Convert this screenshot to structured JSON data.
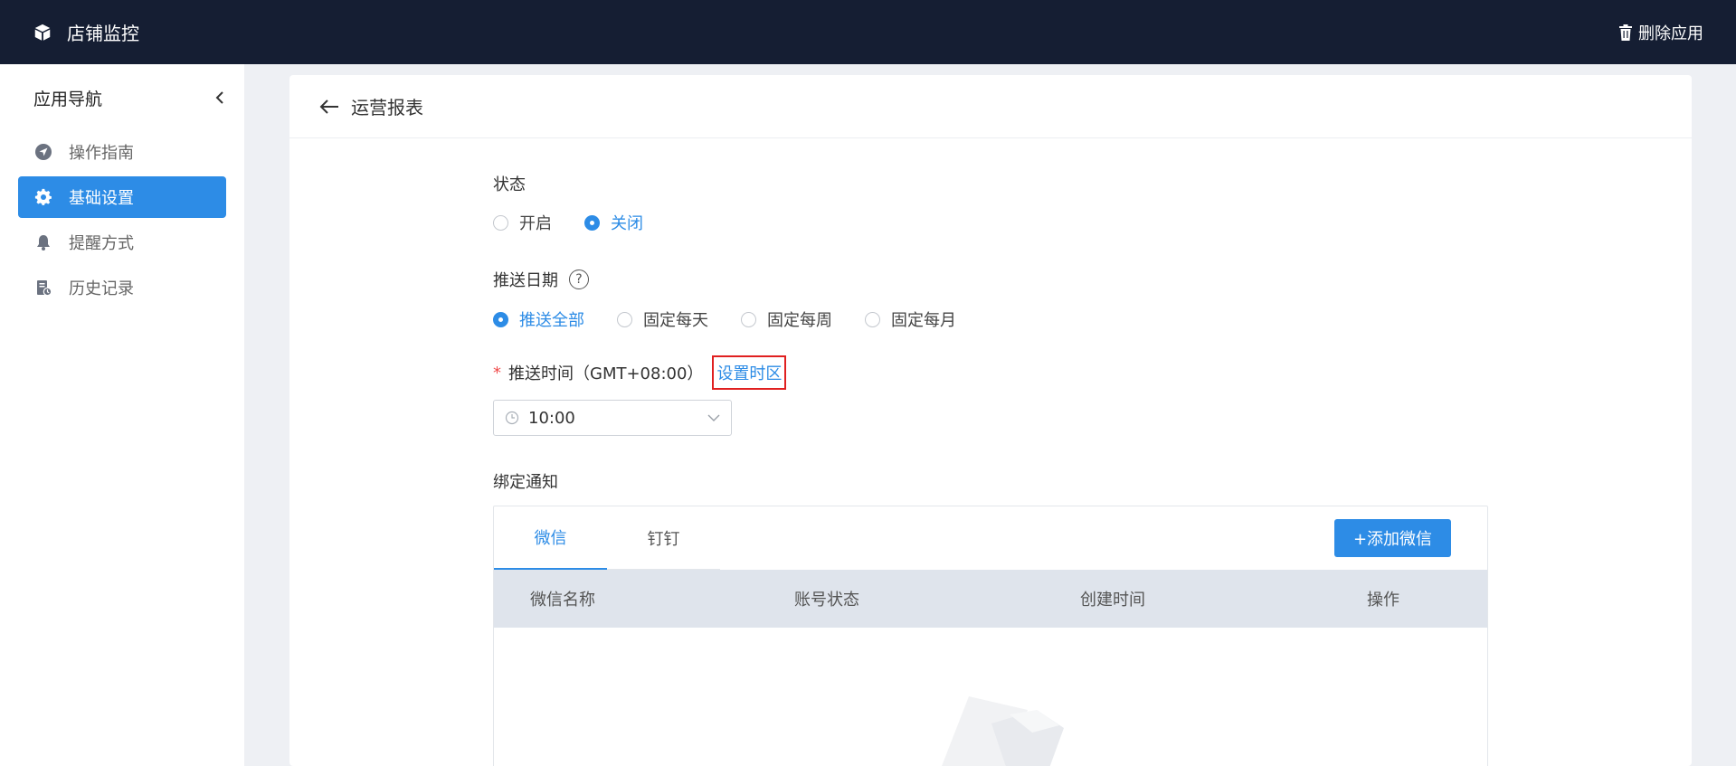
{
  "topbar": {
    "app_title": "店铺监控",
    "delete_label": "删除应用"
  },
  "sidebar": {
    "title": "应用导航",
    "items": [
      {
        "label": "操作指南",
        "icon": "navigation-icon"
      },
      {
        "label": "基础设置",
        "icon": "gear-icon",
        "active": true
      },
      {
        "label": "提醒方式",
        "icon": "bell-icon"
      },
      {
        "label": "历史记录",
        "icon": "history-icon"
      }
    ]
  },
  "page": {
    "title": "运营报表"
  },
  "form": {
    "status_label": "状态",
    "status_options": [
      {
        "label": "开启",
        "checked": false
      },
      {
        "label": "关闭",
        "checked": true
      }
    ],
    "push_date_label": "推送日期",
    "push_date_help": "?",
    "push_date_options": [
      {
        "label": "推送全部",
        "checked": true
      },
      {
        "label": "固定每天",
        "checked": false
      },
      {
        "label": "固定每周",
        "checked": false
      },
      {
        "label": "固定每月",
        "checked": false
      }
    ],
    "push_time_required": "*",
    "push_time_label": "推送时间（GMT+08:00）",
    "set_timezone_link": "设置时区",
    "push_time_value": "10:00",
    "bind_notify_label": "绑定通知"
  },
  "notify": {
    "tabs": [
      {
        "label": "微信",
        "active": true
      },
      {
        "label": "钉钉",
        "active": false
      }
    ],
    "add_button": "+添加微信",
    "columns": [
      "微信名称",
      "账号状态",
      "创建时间",
      "操作"
    ]
  },
  "colors": {
    "topbar_bg": "#151e33",
    "accent": "#2d8ce6",
    "highlight_border": "#e02020"
  }
}
